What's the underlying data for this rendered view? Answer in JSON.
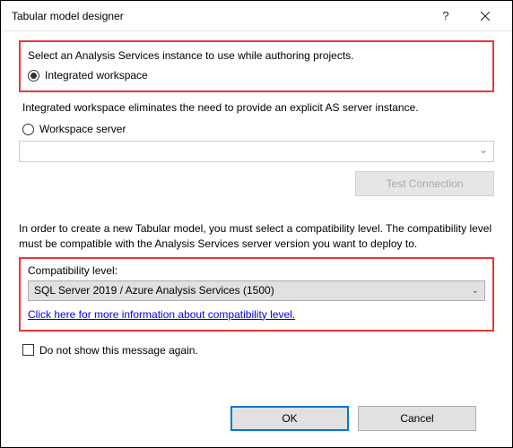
{
  "titlebar": {
    "title": "Tabular model designer"
  },
  "section1": {
    "instruction": "Select an Analysis Services instance to use while authoring projects.",
    "radio_integrated_label": "Integrated workspace",
    "integrated_desc": "Integrated workspace eliminates the need to provide an explicit AS server instance.",
    "radio_server_label": "Workspace server",
    "test_connection_label": "Test Connection"
  },
  "section2": {
    "compat_text": "In order to create a new Tabular model, you must select a compatibility level. The compatibility level must be compatible with the Analysis Services server version you want to deploy to.",
    "compat_label": "Compatibility level:",
    "compat_selected": "SQL Server 2019 / Azure Analysis Services (1500)",
    "link_text": "Click here for more information about compatibility level."
  },
  "checkbox": {
    "label": "Do not show this message again."
  },
  "footer": {
    "ok": "OK",
    "cancel": "Cancel"
  }
}
